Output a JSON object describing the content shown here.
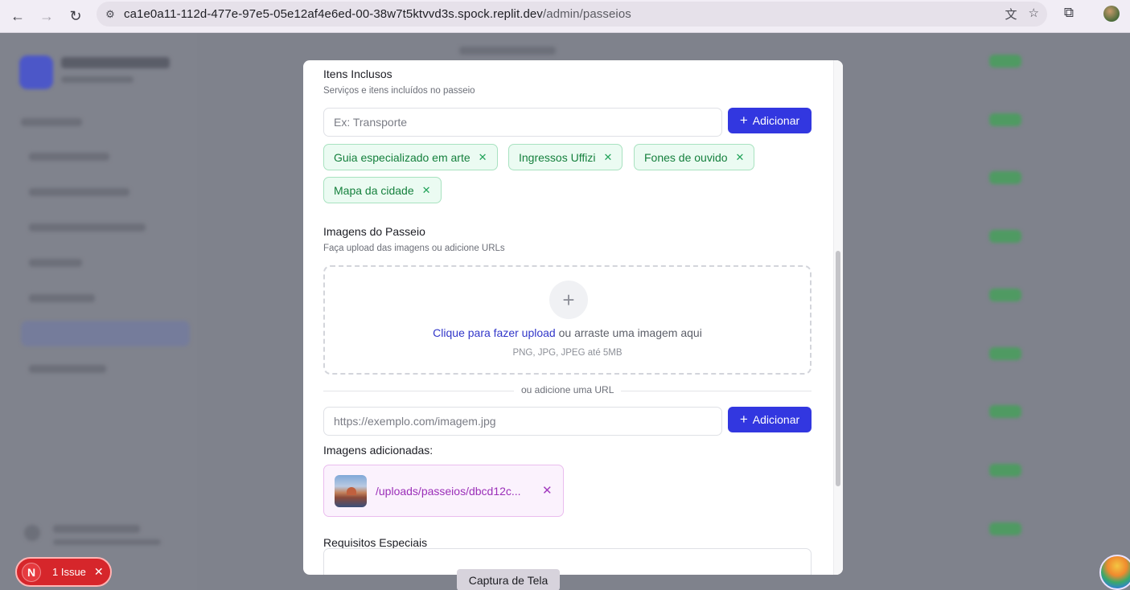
{
  "browser": {
    "url_host": "ca1e0a11-112d-477e-97e5-05e12af4e6ed-00-38w7t5ktvvd3s.spock.replit.dev",
    "url_path": "/admin/passeios"
  },
  "modal": {
    "itens": {
      "title": "Itens Inclusos",
      "subtitle": "Serviços e itens incluídos no passeio",
      "input_placeholder": "Ex: Transporte",
      "add_label": "Adicionar",
      "chips": [
        "Guia especializado em arte",
        "Ingressos Uffizi",
        "Fones de ouvido",
        "Mapa da cidade"
      ]
    },
    "imagens": {
      "title": "Imagens do Passeio",
      "subtitle": "Faça upload das imagens ou adicione URLs",
      "upload_link": "Clique para fazer upload",
      "upload_text": " ou arraste uma imagem aqui",
      "upload_hint": "PNG, JPG, JPEG até 5MB",
      "divider_label": "ou adicione uma URL",
      "url_placeholder": "https://exemplo.com/imagem.jpg",
      "add_label": "Adicionar",
      "added_title": "Imagens adicionadas:",
      "added_images": [
        {
          "path": "/uploads/passeios/dbcd12c..."
        }
      ]
    },
    "requisitos": {
      "title": "Requisitos Especiais"
    }
  },
  "overlay": {
    "issue_letter": "N",
    "issue_label": "1 Issue",
    "capture_label": "Captura de Tela"
  },
  "colors": {
    "primary": "#3237e0",
    "chip_green": "#15803d",
    "image_purple": "#9b2fb8",
    "issue_red": "#d6262b"
  }
}
